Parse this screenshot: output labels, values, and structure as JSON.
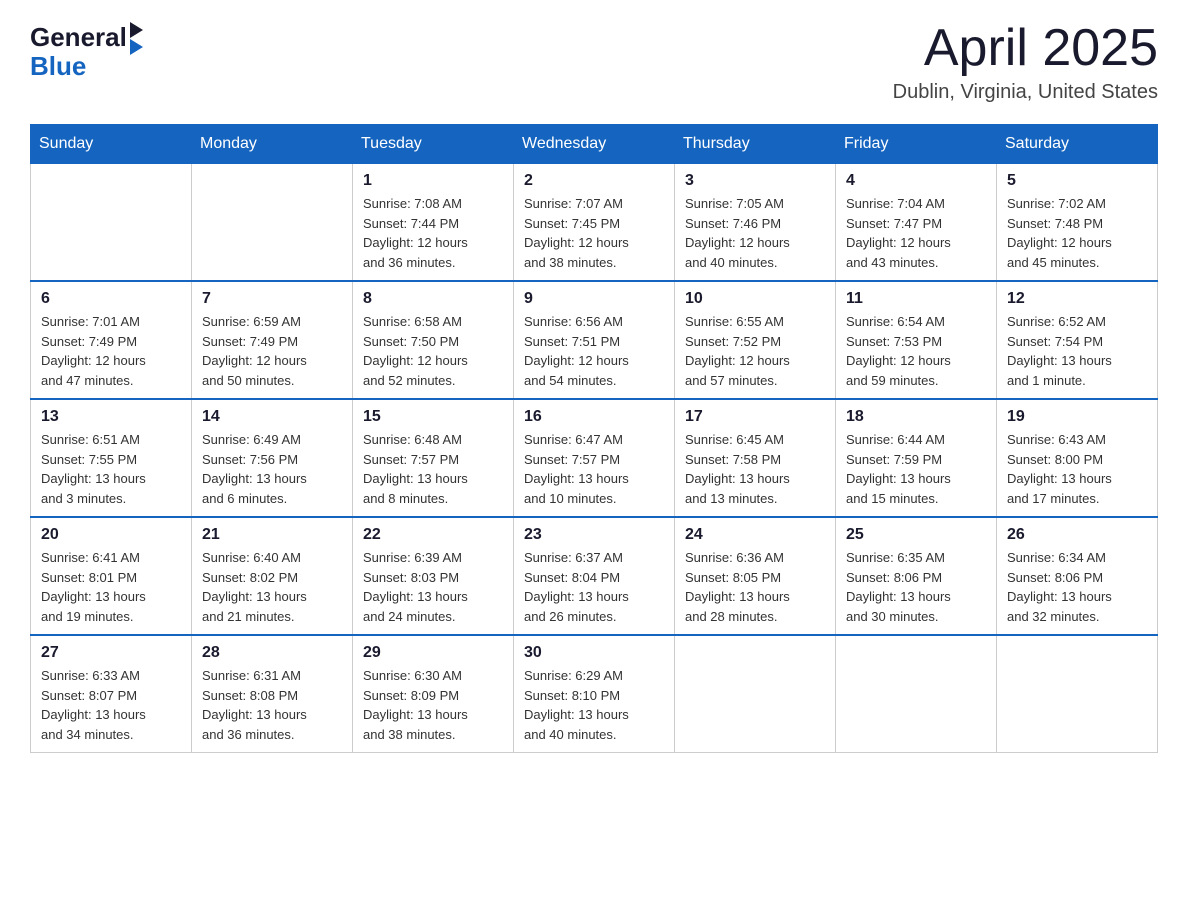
{
  "header": {
    "logo_general": "General",
    "logo_blue": "Blue",
    "month_title": "April 2025",
    "location": "Dublin, Virginia, United States"
  },
  "days_of_week": [
    "Sunday",
    "Monday",
    "Tuesday",
    "Wednesday",
    "Thursday",
    "Friday",
    "Saturday"
  ],
  "weeks": [
    [
      {
        "day": "",
        "info": ""
      },
      {
        "day": "",
        "info": ""
      },
      {
        "day": "1",
        "info": "Sunrise: 7:08 AM\nSunset: 7:44 PM\nDaylight: 12 hours\nand 36 minutes."
      },
      {
        "day": "2",
        "info": "Sunrise: 7:07 AM\nSunset: 7:45 PM\nDaylight: 12 hours\nand 38 minutes."
      },
      {
        "day": "3",
        "info": "Sunrise: 7:05 AM\nSunset: 7:46 PM\nDaylight: 12 hours\nand 40 minutes."
      },
      {
        "day": "4",
        "info": "Sunrise: 7:04 AM\nSunset: 7:47 PM\nDaylight: 12 hours\nand 43 minutes."
      },
      {
        "day": "5",
        "info": "Sunrise: 7:02 AM\nSunset: 7:48 PM\nDaylight: 12 hours\nand 45 minutes."
      }
    ],
    [
      {
        "day": "6",
        "info": "Sunrise: 7:01 AM\nSunset: 7:49 PM\nDaylight: 12 hours\nand 47 minutes."
      },
      {
        "day": "7",
        "info": "Sunrise: 6:59 AM\nSunset: 7:49 PM\nDaylight: 12 hours\nand 50 minutes."
      },
      {
        "day": "8",
        "info": "Sunrise: 6:58 AM\nSunset: 7:50 PM\nDaylight: 12 hours\nand 52 minutes."
      },
      {
        "day": "9",
        "info": "Sunrise: 6:56 AM\nSunset: 7:51 PM\nDaylight: 12 hours\nand 54 minutes."
      },
      {
        "day": "10",
        "info": "Sunrise: 6:55 AM\nSunset: 7:52 PM\nDaylight: 12 hours\nand 57 minutes."
      },
      {
        "day": "11",
        "info": "Sunrise: 6:54 AM\nSunset: 7:53 PM\nDaylight: 12 hours\nand 59 minutes."
      },
      {
        "day": "12",
        "info": "Sunrise: 6:52 AM\nSunset: 7:54 PM\nDaylight: 13 hours\nand 1 minute."
      }
    ],
    [
      {
        "day": "13",
        "info": "Sunrise: 6:51 AM\nSunset: 7:55 PM\nDaylight: 13 hours\nand 3 minutes."
      },
      {
        "day": "14",
        "info": "Sunrise: 6:49 AM\nSunset: 7:56 PM\nDaylight: 13 hours\nand 6 minutes."
      },
      {
        "day": "15",
        "info": "Sunrise: 6:48 AM\nSunset: 7:57 PM\nDaylight: 13 hours\nand 8 minutes."
      },
      {
        "day": "16",
        "info": "Sunrise: 6:47 AM\nSunset: 7:57 PM\nDaylight: 13 hours\nand 10 minutes."
      },
      {
        "day": "17",
        "info": "Sunrise: 6:45 AM\nSunset: 7:58 PM\nDaylight: 13 hours\nand 13 minutes."
      },
      {
        "day": "18",
        "info": "Sunrise: 6:44 AM\nSunset: 7:59 PM\nDaylight: 13 hours\nand 15 minutes."
      },
      {
        "day": "19",
        "info": "Sunrise: 6:43 AM\nSunset: 8:00 PM\nDaylight: 13 hours\nand 17 minutes."
      }
    ],
    [
      {
        "day": "20",
        "info": "Sunrise: 6:41 AM\nSunset: 8:01 PM\nDaylight: 13 hours\nand 19 minutes."
      },
      {
        "day": "21",
        "info": "Sunrise: 6:40 AM\nSunset: 8:02 PM\nDaylight: 13 hours\nand 21 minutes."
      },
      {
        "day": "22",
        "info": "Sunrise: 6:39 AM\nSunset: 8:03 PM\nDaylight: 13 hours\nand 24 minutes."
      },
      {
        "day": "23",
        "info": "Sunrise: 6:37 AM\nSunset: 8:04 PM\nDaylight: 13 hours\nand 26 minutes."
      },
      {
        "day": "24",
        "info": "Sunrise: 6:36 AM\nSunset: 8:05 PM\nDaylight: 13 hours\nand 28 minutes."
      },
      {
        "day": "25",
        "info": "Sunrise: 6:35 AM\nSunset: 8:06 PM\nDaylight: 13 hours\nand 30 minutes."
      },
      {
        "day": "26",
        "info": "Sunrise: 6:34 AM\nSunset: 8:06 PM\nDaylight: 13 hours\nand 32 minutes."
      }
    ],
    [
      {
        "day": "27",
        "info": "Sunrise: 6:33 AM\nSunset: 8:07 PM\nDaylight: 13 hours\nand 34 minutes."
      },
      {
        "day": "28",
        "info": "Sunrise: 6:31 AM\nSunset: 8:08 PM\nDaylight: 13 hours\nand 36 minutes."
      },
      {
        "day": "29",
        "info": "Sunrise: 6:30 AM\nSunset: 8:09 PM\nDaylight: 13 hours\nand 38 minutes."
      },
      {
        "day": "30",
        "info": "Sunrise: 6:29 AM\nSunset: 8:10 PM\nDaylight: 13 hours\nand 40 minutes."
      },
      {
        "day": "",
        "info": ""
      },
      {
        "day": "",
        "info": ""
      },
      {
        "day": "",
        "info": ""
      }
    ]
  ]
}
